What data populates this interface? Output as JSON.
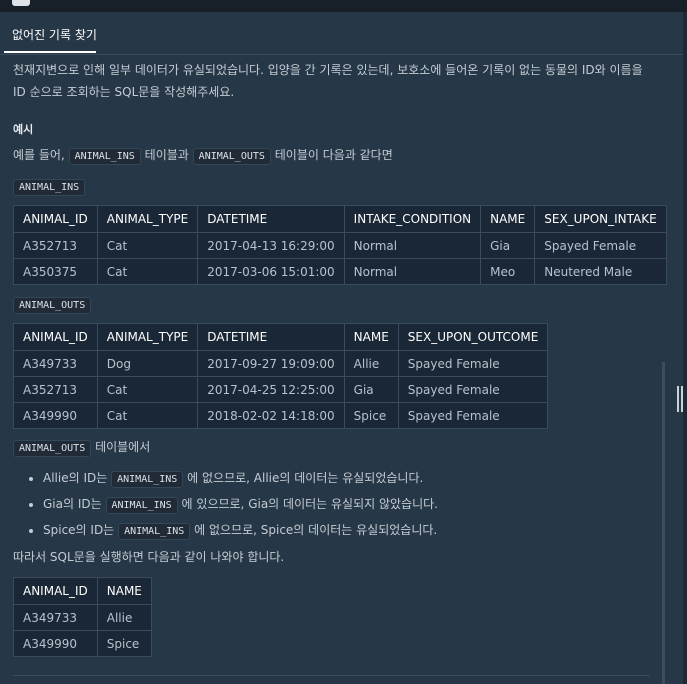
{
  "tab": {
    "title": "없어진 기록 찾기"
  },
  "intro": "천재지변으로 인해 일부 데이터가 유실되었습니다. 입양을 간 기록은 있는데, 보호소에 들어온 기록이 없는 동물의 ID와 이름을 ID 순으로 조회하는 SQL문을 작성해주세요.",
  "example_heading": "예시",
  "example_line": {
    "pre": "예를 들어,",
    "code1": "ANIMAL_INS",
    "mid": "테이블과",
    "code2": "ANIMAL_OUTS",
    "post": "테이블이 다음과 같다면"
  },
  "ins_label": "ANIMAL_INS",
  "ins_table": {
    "headers": [
      "ANIMAL_ID",
      "ANIMAL_TYPE",
      "DATETIME",
      "INTAKE_CONDITION",
      "NAME",
      "SEX_UPON_INTAKE"
    ],
    "rows": [
      [
        "A352713",
        "Cat",
        "2017-04-13 16:29:00",
        "Normal",
        "Gia",
        "Spayed Female"
      ],
      [
        "A350375",
        "Cat",
        "2017-03-06 15:01:00",
        "Normal",
        "Meo",
        "Neutered Male"
      ]
    ]
  },
  "outs_label": "ANIMAL_OUTS",
  "outs_table": {
    "headers": [
      "ANIMAL_ID",
      "ANIMAL_TYPE",
      "DATETIME",
      "NAME",
      "SEX_UPON_OUTCOME"
    ],
    "rows": [
      [
        "A349733",
        "Dog",
        "2017-09-27 19:09:00",
        "Allie",
        "Spayed Female"
      ],
      [
        "A352713",
        "Cat",
        "2017-04-25 12:25:00",
        "Gia",
        "Spayed Female"
      ],
      [
        "A349990",
        "Cat",
        "2018-02-02 14:18:00",
        "Spice",
        "Spayed Female"
      ]
    ]
  },
  "outs_note": {
    "code": "ANIMAL_OUTS",
    "text": "테이블에서"
  },
  "bullets": [
    {
      "pre": "Allie의 ID는",
      "code": "ANIMAL_INS",
      "post": "에 없으므로, Allie의 데이터는 유실되었습니다."
    },
    {
      "pre": "Gia의 ID는",
      "code": "ANIMAL_INS",
      "post": "에 있으므로, Gia의 데이터는 유실되지 않았습니다."
    },
    {
      "pre": "Spice의 ID는",
      "code": "ANIMAL_INS",
      "post": "에 없으므로, Spice의 데이터는 유실되었습니다."
    }
  ],
  "conclusion": "따라서 SQL문을 실행하면 다음과 같이 나와야 합니다.",
  "result_table": {
    "headers": [
      "ANIMAL_ID",
      "NAME"
    ],
    "rows": [
      [
        "A349733",
        "Allie"
      ],
      [
        "A349990",
        "Spice"
      ]
    ]
  }
}
